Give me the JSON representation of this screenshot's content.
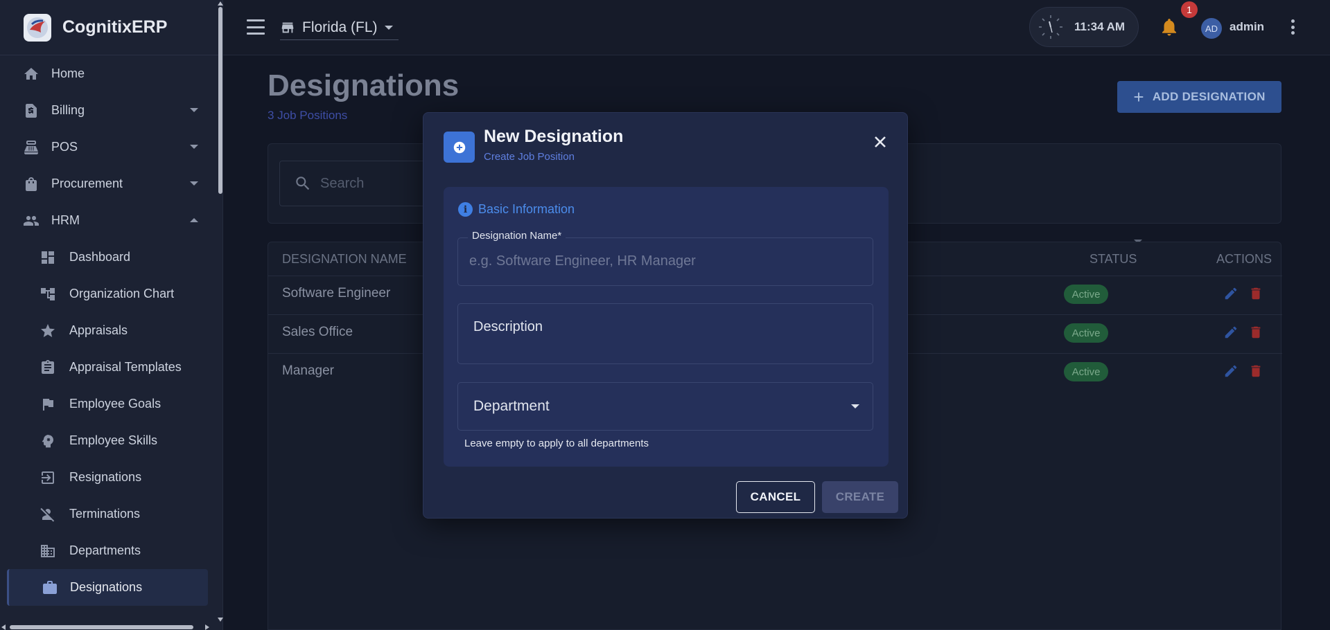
{
  "app": {
    "name": "CognitixERP"
  },
  "sidebar": {
    "items": [
      {
        "label": "Home",
        "icon": "home-icon"
      },
      {
        "label": "Billing",
        "icon": "billing-icon",
        "expandable": true
      },
      {
        "label": "POS",
        "icon": "pos-icon",
        "expandable": true
      },
      {
        "label": "Procurement",
        "icon": "procurement-icon",
        "expandable": true
      },
      {
        "label": "HRM",
        "icon": "people-icon",
        "expanded": true
      }
    ],
    "hrm_items": [
      {
        "label": "Dashboard",
        "icon": "dashboard-icon"
      },
      {
        "label": "Organization Chart",
        "icon": "org-chart-icon"
      },
      {
        "label": "Appraisals",
        "icon": "star-icon"
      },
      {
        "label": "Appraisal Templates",
        "icon": "clipboard-icon"
      },
      {
        "label": "Employee Goals",
        "icon": "flag-icon"
      },
      {
        "label": "Employee Skills",
        "icon": "skills-icon"
      },
      {
        "label": "Resignations",
        "icon": "exit-icon"
      },
      {
        "label": "Terminations",
        "icon": "person-off-icon"
      },
      {
        "label": "Departments",
        "icon": "building-icon"
      },
      {
        "label": "Designations",
        "icon": "briefcase-icon",
        "active": true
      }
    ]
  },
  "topbar": {
    "store": "Florida (FL)",
    "time": "11:34 AM",
    "notifications": "1",
    "avatar": "AD",
    "user": "admin"
  },
  "page": {
    "title": "Designations",
    "subtitle": "3 Job Positions",
    "add_button": "ADD DESIGNATION",
    "search_placeholder": "Search"
  },
  "table": {
    "columns": {
      "name": "DESIGNATION NAME",
      "status": "STATUS",
      "actions": "ACTIONS"
    },
    "rows": [
      {
        "name": "Software Engineer",
        "status": "Active"
      },
      {
        "name": "Sales Office",
        "status": "Active"
      },
      {
        "name": "Manager",
        "status": "Active"
      }
    ]
  },
  "dialog": {
    "title": "New Designation",
    "subtitle": "Create Job Position",
    "section_title": "Basic Information",
    "name_label": "Designation Name*",
    "name_placeholder": "e.g. Software Engineer, HR Manager",
    "description_label": "Description",
    "department_label": "Department",
    "department_helper": "Leave empty to apply to all departments",
    "cancel": "CANCEL",
    "create": "CREATE"
  },
  "colors": {
    "accent": "#3d73d6",
    "status_active": "#215c3a",
    "delete": "#9b2b2b",
    "bell": "#d48a1e"
  }
}
